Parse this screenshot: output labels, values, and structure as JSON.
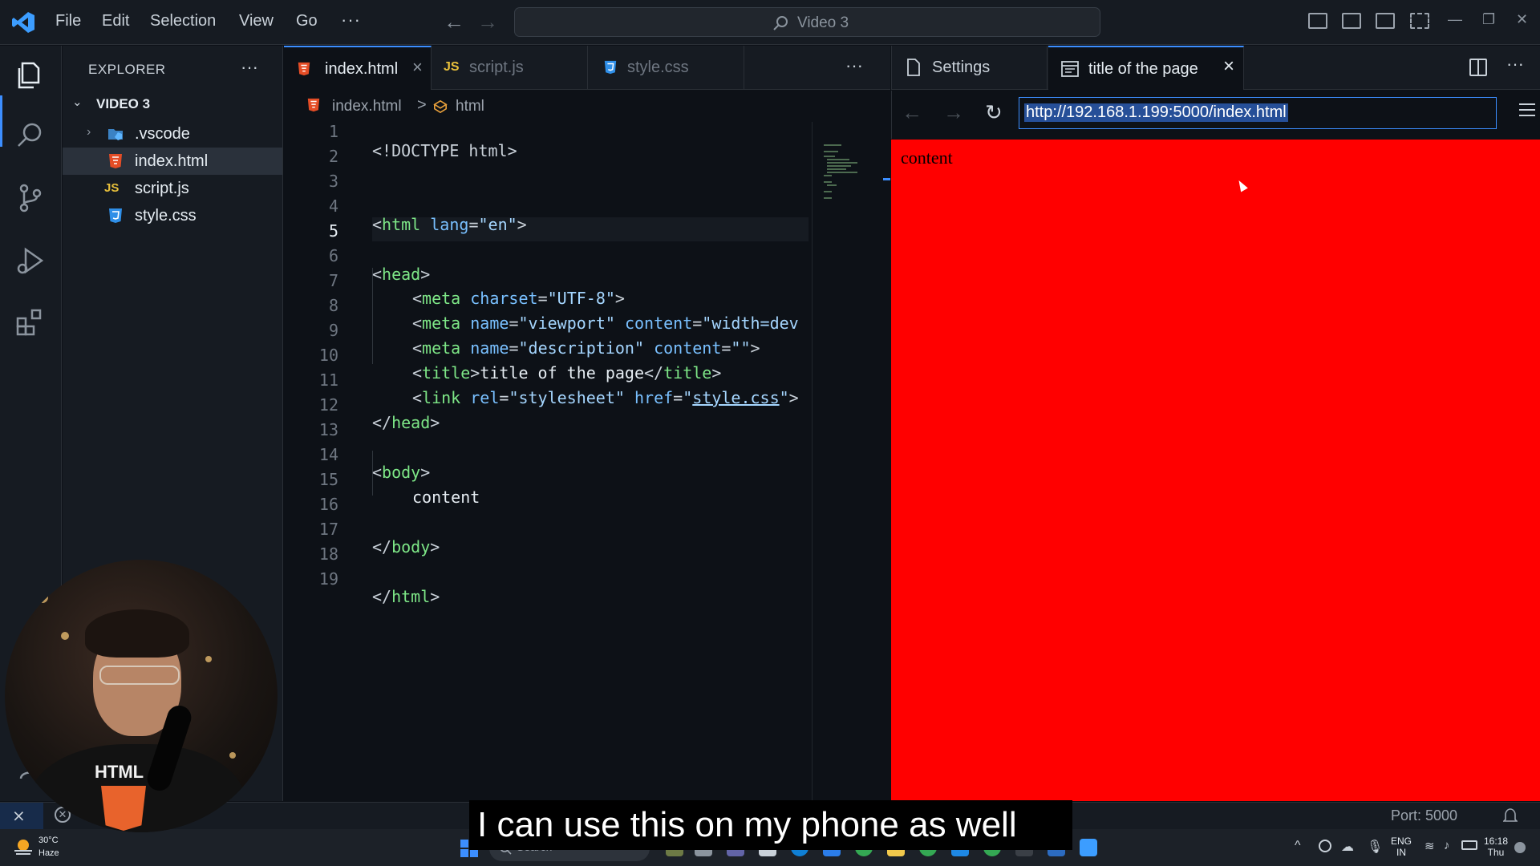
{
  "title_bar": {
    "menus": [
      "File",
      "Edit",
      "Selection",
      "View",
      "Go"
    ],
    "more": "···",
    "command_center": "Video 3"
  },
  "explorer": {
    "title": "EXPLORER",
    "more": "···",
    "folder": "VIDEO 3",
    "items": [
      {
        "label": ".vscode",
        "icon": "vscode-folder-icon",
        "type": "folder"
      },
      {
        "label": "index.html",
        "icon": "html5-icon",
        "type": "file",
        "selected": true
      },
      {
        "label": "script.js",
        "icon": "js-icon",
        "type": "file"
      },
      {
        "label": "style.css",
        "icon": "css3-icon",
        "type": "file"
      }
    ]
  },
  "editor": {
    "tabs": [
      {
        "label": "index.html",
        "active": true,
        "close": "×"
      },
      {
        "label": "script.js",
        "active": false
      },
      {
        "label": "style.css",
        "active": false
      }
    ],
    "tabs_more": "···",
    "breadcrumb": {
      "file": "index.html",
      "separator": ">",
      "node": "html"
    },
    "active_line": 5,
    "line_numbers": [
      "1",
      "2",
      "3",
      "4",
      "5",
      "6",
      "7",
      "8",
      "9",
      "10",
      "11",
      "12",
      "13",
      "14",
      "15",
      "16",
      "17",
      "18",
      "19"
    ],
    "code": {
      "l1": {
        "doctype": "<!DOCTYPE html>"
      },
      "l4": {
        "tag": "html",
        "attr": "lang",
        "val": "\"en\""
      },
      "l6": {
        "tag": "head"
      },
      "l7": {
        "tag": "meta",
        "attr": "charset",
        "val": "\"UTF-8\""
      },
      "l8": {
        "tag": "meta",
        "attr1": "name",
        "val1": "\"viewport\"",
        "attr2": "content",
        "val2": "\"width=dev"
      },
      "l9": {
        "tag": "meta",
        "attr1": "name",
        "val1": "\"description\"",
        "attr2": "content",
        "val2": "\"\""
      },
      "l10": {
        "tag": "title",
        "text": "title of the page",
        "closetag": "title"
      },
      "l11": {
        "tag": "link",
        "attr1": "rel",
        "val1": "\"stylesheet\"",
        "attr2": "href",
        "val2a": "\"",
        "val2b": "style.css",
        "val2c": "\""
      },
      "l12": {
        "tag": "head"
      },
      "l14": {
        "tag": "body"
      },
      "l15": {
        "text": "content"
      },
      "l17": {
        "tag": "body"
      },
      "l19": {
        "tag": "html"
      }
    }
  },
  "browser": {
    "tabs": [
      {
        "label": "Settings",
        "icon": "file-icon"
      },
      {
        "label": "title of the page",
        "icon": "browser-preview-icon",
        "active": true,
        "close": "×"
      }
    ],
    "more": "···",
    "back": "←",
    "forward": "→",
    "reload": "↻",
    "url": "http://192.168.1.199:5000/index.html",
    "page_text": "content",
    "page_background": "#ff0000"
  },
  "status_bar": {
    "port": "Port: 5000"
  },
  "taskbar": {
    "weather_temp": "30°C",
    "weather_cond": "Haze",
    "search": "Search",
    "lang_line1": "ENG",
    "lang_line2": "IN",
    "time_line1": "16:18",
    "time_line2": "Thu"
  },
  "overlay": {
    "caption": "I can use this on my phone as well",
    "shirt_text": "HTML"
  },
  "colors": {
    "accent": "#3c8eff",
    "tag": "#7ee787",
    "attribute": "#79c0ff",
    "string": "#a5d6ff"
  }
}
